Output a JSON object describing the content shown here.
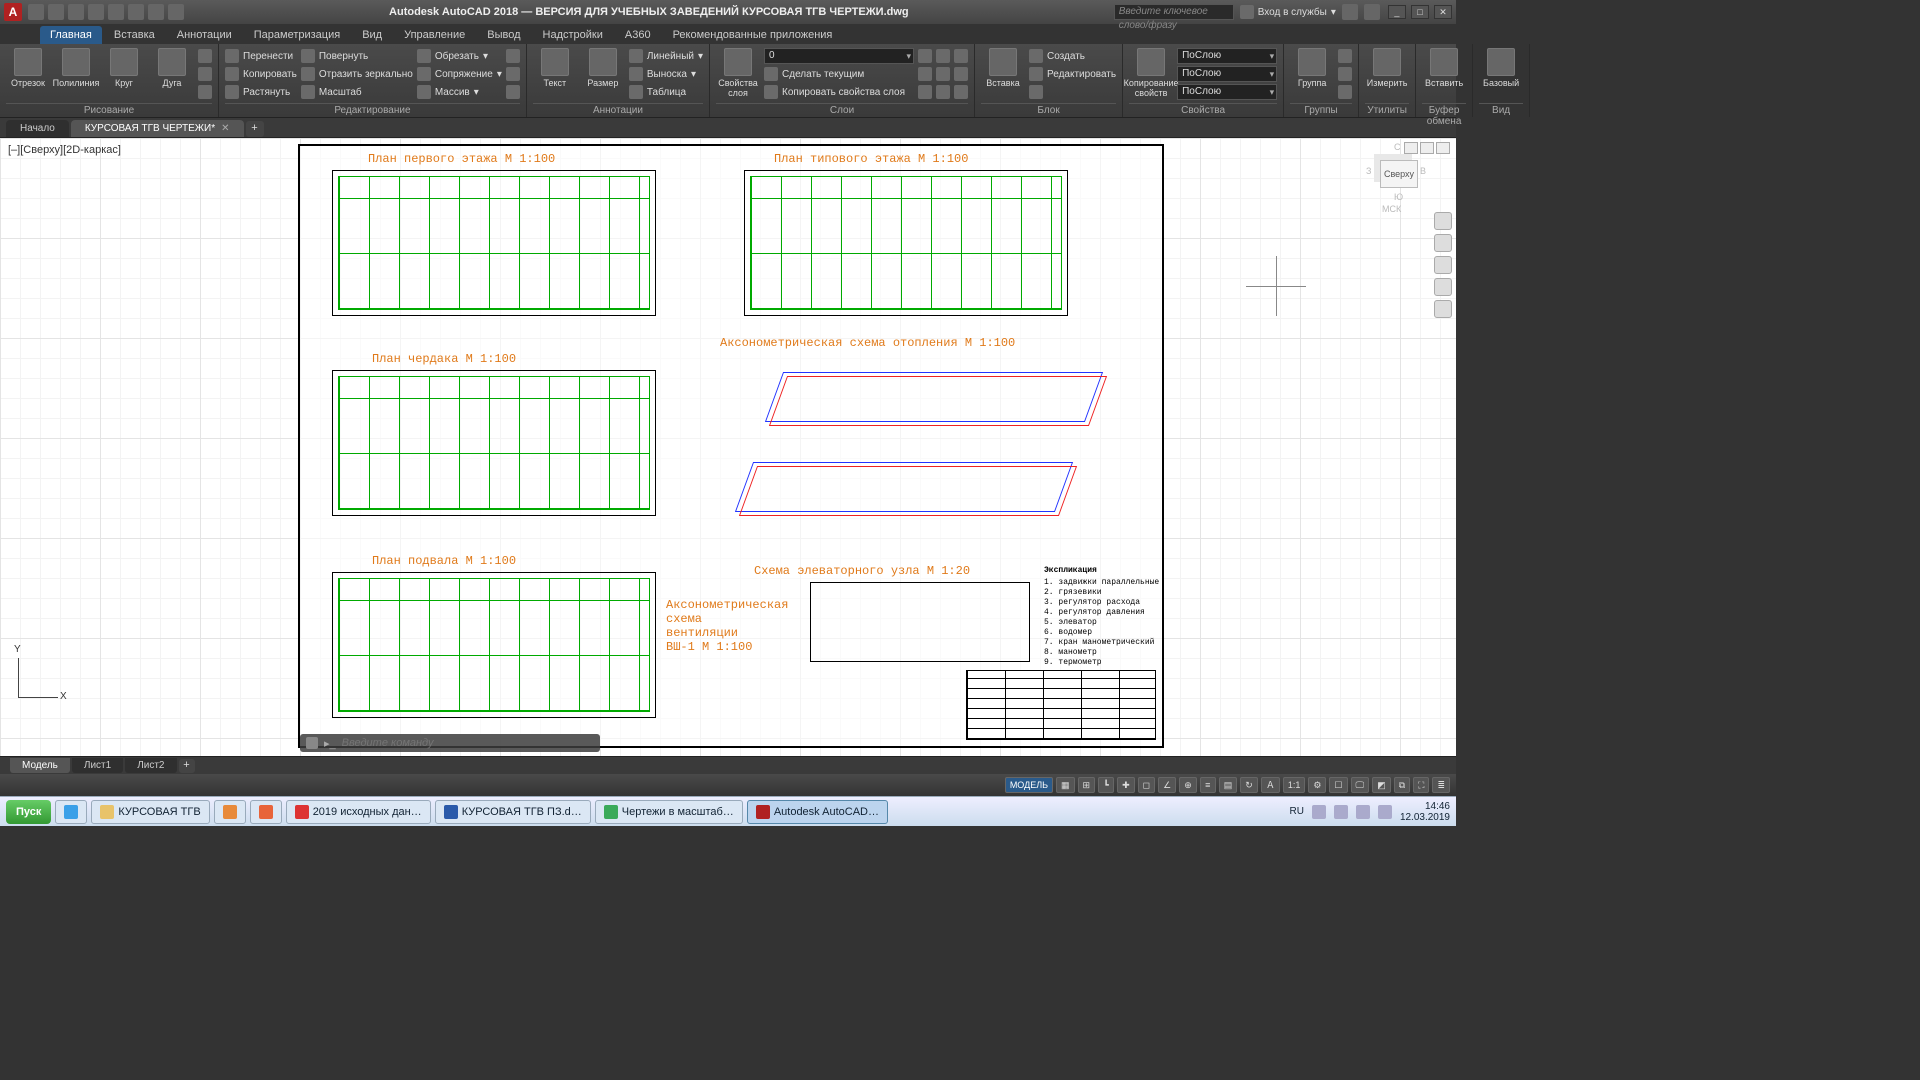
{
  "title_bar": {
    "app_letter": "A",
    "title": "Autodesk AutoCAD 2018 — ВЕРСИЯ ДЛЯ УЧЕБНЫХ ЗАВЕДЕНИЙ    КУРСОВАЯ ТГВ ЧЕРТЕЖИ.dwg",
    "search_placeholder": "Введите ключевое слово/фразу",
    "sign_in": "Вход в службы",
    "qat_icons": [
      "new",
      "open",
      "save",
      "undo",
      "redo",
      "plot",
      "a360",
      "arrow"
    ]
  },
  "ribbon_tabs": [
    "Главная",
    "Вставка",
    "Аннотации",
    "Параметризация",
    "Вид",
    "Управление",
    "Вывод",
    "Надстройки",
    "A360",
    "Рекомендованные приложения"
  ],
  "ribbon_active": 0,
  "ribbon": {
    "draw": {
      "title": "Рисование",
      "big": [
        {
          "n": "line",
          "l": "Отрезок"
        },
        {
          "n": "pline",
          "l": "Полилиния"
        },
        {
          "n": "circle",
          "l": "Круг"
        },
        {
          "n": "arc",
          "l": "Дуга"
        }
      ]
    },
    "modify": {
      "title": "Редактирование",
      "rows": [
        [
          "Перенести",
          "Повернуть",
          "Обрезать"
        ],
        [
          "Копировать",
          "Отразить зеркально",
          "Сопряжение"
        ],
        [
          "Растянуть",
          "Масштаб",
          "Массив"
        ]
      ]
    },
    "annot": {
      "title": "Аннотации",
      "big": [
        {
          "n": "text",
          "l": "Текст"
        },
        {
          "n": "dim",
          "l": "Размер"
        }
      ],
      "rows": [
        [
          "Линейный"
        ],
        [
          "Выноска"
        ],
        [
          "Таблица"
        ]
      ]
    },
    "layers": {
      "title": "Слои",
      "big": [
        {
          "n": "layerprops",
          "l": "Свойства\nслоя"
        }
      ],
      "combo_value": "0",
      "rows": [
        [
          "Сделать текущим"
        ],
        [
          "Копировать свойства слоя"
        ]
      ]
    },
    "block": {
      "title": "Блок",
      "big": [
        {
          "n": "insert",
          "l": "Вставка"
        }
      ],
      "rows": [
        [
          "Создать"
        ],
        [
          "Редактировать"
        ]
      ]
    },
    "props": {
      "title": "Свойства",
      "big": [
        {
          "n": "matchprop",
          "l": "Копирование\nсвойств"
        }
      ],
      "combos": [
        "ПоСлою",
        "ПоСлою",
        "ПоСлою"
      ]
    },
    "groups": {
      "title": "Группы",
      "big": [
        {
          "n": "group",
          "l": "Группа"
        }
      ]
    },
    "utils": {
      "title": "Утилиты",
      "big": [
        {
          "n": "measure",
          "l": "Измерить"
        }
      ]
    },
    "clip": {
      "title": "Буфер обмена",
      "big": [
        {
          "n": "paste",
          "l": "Вставить"
        }
      ]
    },
    "view": {
      "title": "Вид",
      "big": [
        {
          "n": "base",
          "l": "Базовый"
        }
      ]
    }
  },
  "file_tabs": {
    "items": [
      "Начало",
      "КУРСОВАЯ ТГВ ЧЕРТЕЖИ*"
    ],
    "active": 1,
    "add": "+"
  },
  "viewport": {
    "label": "[–][Сверху][2D-каркас]",
    "vcube_face": "Сверху",
    "vcube_labels": {
      "n": "С",
      "s": "Ю",
      "e": "В",
      "w": "З",
      "wcs": "МСК"
    },
    "cmd_placeholder": "Введите команду",
    "ucs": {
      "x": "X",
      "y": "Y"
    }
  },
  "drawings": {
    "t1": "План первого этажа М 1:100",
    "t2": "План типового этажа М 1:100",
    "t3": "План чердака М 1:100",
    "t4": "Аксонометрическая схема       отопления М 1:100",
    "t5": "План подвала М 1:100",
    "t6": "Схема элеваторного узла М 1:20",
    "t7": "Аксонометрическая\nсхема\nвентиляции\nВШ-1 М 1:100",
    "expl_head": "Экспликация",
    "expl": [
      "1. задвижки параллельные",
      "2. грязевики",
      "3. регулятор расхода",
      "4. регулятор давления",
      "5. элеватор",
      "6. водомер",
      "7. кран манометрический",
      "8. манометр",
      "9. термометр"
    ]
  },
  "layout_tabs": {
    "items": [
      "Модель",
      "Лист1",
      "Лист2"
    ],
    "active": 0,
    "add": "+"
  },
  "status_bar": {
    "model": "МОДЕЛЬ",
    "scale": "1:1",
    "icons": [
      "grid",
      "snap",
      "ortho",
      "polar",
      "osnap",
      "otrack",
      "dyn",
      "lwt",
      "trans",
      "cycle",
      "3dosnap",
      "ucs",
      "ann",
      "auto",
      "ws",
      "mon",
      "iso",
      "hw",
      "clean",
      "cust"
    ]
  },
  "taskbar": {
    "start": "Пуск",
    "items": [
      {
        "l": "КУРСОВАЯ ТГВ",
        "i": "folder"
      },
      {
        "l": "",
        "i": "wmp"
      },
      {
        "l": "",
        "i": "firefox"
      },
      {
        "l": "2019 исходных дан…",
        "i": "pdf"
      },
      {
        "l": "КУРСОВАЯ ТГВ ПЗ.d…",
        "i": "word"
      },
      {
        "l": "Чертежи в масштаб…",
        "i": "chrome"
      },
      {
        "l": "Autodesk AutoCAD…",
        "i": "acad",
        "active": true
      }
    ],
    "lang": "RU",
    "time": "14:46",
    "date": "12.03.2019"
  }
}
